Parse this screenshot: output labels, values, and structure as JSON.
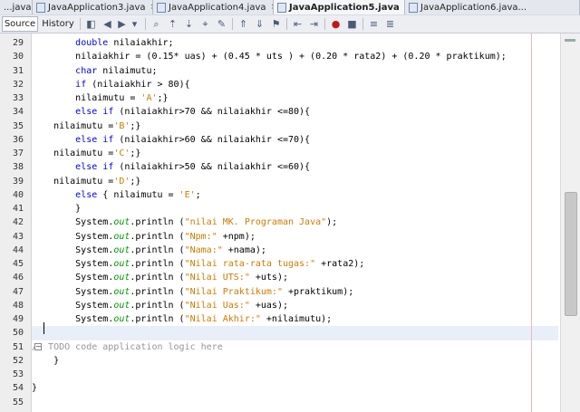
{
  "tabs": [
    {
      "label": "...java",
      "close": "×"
    },
    {
      "label": "JavaApplication3.java",
      "close": "×"
    },
    {
      "label": "JavaApplication4.java",
      "close": "×"
    },
    {
      "label": "JavaApplication5.java",
      "close": "×",
      "active": true
    },
    {
      "label": "JavaApplication6.java...",
      "close": ""
    }
  ],
  "toolbar": {
    "source_label": "Source",
    "history_label": "History"
  },
  "editor": {
    "line_numbers": [
      "29",
      "30",
      "31",
      "32",
      "33",
      "34",
      "35",
      "36",
      "37",
      "38",
      "39",
      "40",
      "41",
      "42",
      "43",
      "44",
      "45",
      "46",
      "47",
      "48",
      "49",
      "50",
      "51",
      "52",
      "53",
      "54",
      "55"
    ],
    "lines": [
      "        double nilaiakhir;",
      "        nilaiakhir = (0.15* uas) + (0.45 * uts ) + (0.20 * rata2) + (0.20 * praktikum);",
      "        char nilaimutu;",
      "        if (nilaiakhir > 80){",
      "        nilaimutu = 'A';}",
      "        else if (nilaiakhir>70 && nilaiakhir <=80){",
      "    nilaimutu ='B';}",
      "        else if (nilaiakhir>60 && nilaiakhir <=70){",
      "    nilaimutu ='C';}",
      "        else if (nilaiakhir>50 && nilaiakhir <=60){",
      "    nilaimutu ='D';}",
      "        else { nilaimutu = 'E';",
      "        }",
      "        System.out.println (\"nilai MK. Programan Java\");",
      "        System.out.println (\"Npm:\" +npm);",
      "        System.out.println (\"Nama:\" +nama);",
      "        System.out.println (\"Nilai rata-rata tugas:\" +rata2);",
      "        System.out.println (\"Nilai UTS:\" +uts);",
      "        System.out.println (\"Nilai Praktikum:\" +praktikum);",
      "        System.out.println (\"Nilai Uas:\" +uas);",
      "        System.out.println (\"Nilai Akhir:\" +nilaimutu);",
      "",
      "// TODO code application logic here",
      "    }",
      "",
      "}",
      ""
    ]
  }
}
